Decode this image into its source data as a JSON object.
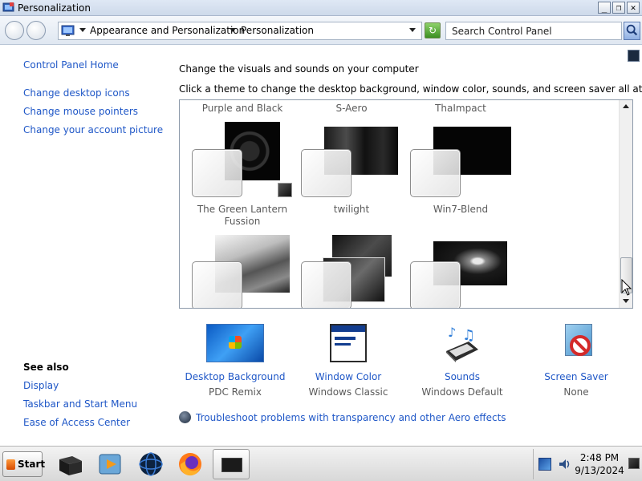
{
  "window": {
    "title": "Personalization",
    "minimize_glyph": "_",
    "restore_glyph": "❐",
    "close_glyph": "✕"
  },
  "address": {
    "crumbs": [
      "Appearance and Personalization",
      "Personalization"
    ],
    "search_placeholder": "Search Control Panel"
  },
  "sidebar": {
    "links": [
      "Control Panel Home",
      "Change desktop icons",
      "Change mouse pointers",
      "Change your account picture"
    ],
    "see_also_heading": "See also",
    "see_also_links": [
      "Display",
      "Taskbar and Start Menu",
      "Ease of Access Center"
    ]
  },
  "main": {
    "heading": "Change the visuals and sounds on your computer",
    "instruction": "Click a theme to change the desktop background, window color, sounds, and screen saver all at once.",
    "themes": [
      {
        "name": "Purple and Black"
      },
      {
        "name": "S-Aero"
      },
      {
        "name": "ThaImpact"
      },
      {
        "name": "The Green Lantern Fussion"
      },
      {
        "name": "twilight"
      },
      {
        "name": "Win7-Blend"
      }
    ],
    "options": [
      {
        "label": "Desktop Background",
        "value": "PDC Remix",
        "icon": "desktop-background-icon"
      },
      {
        "label": "Window Color",
        "value": "Windows Classic",
        "icon": "window-color-icon"
      },
      {
        "label": "Sounds",
        "value": "Windows Default",
        "icon": "sounds-icon"
      },
      {
        "label": "Screen Saver",
        "value": "None",
        "icon": "screen-saver-icon"
      }
    ],
    "troubleshoot_link": "Troubleshoot problems with transparency and other Aero effects"
  },
  "taskbar": {
    "start_label": "Start",
    "time": "2:48 PM",
    "date": "9/13/2024",
    "pinned": [
      "explorer-icon",
      "media-player-icon",
      "globe-icon",
      "firefox-icon",
      "personalization-window-icon"
    ]
  }
}
